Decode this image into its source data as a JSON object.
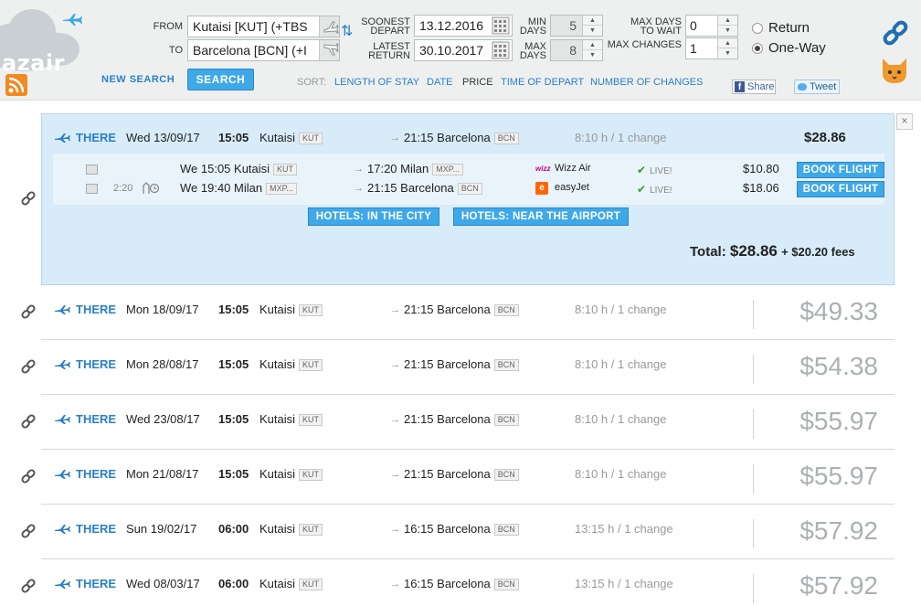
{
  "header": {
    "logo_text": "azair",
    "labels": {
      "from": "FROM",
      "to": "TO",
      "soonest_depart": [
        "SOONEST",
        "DEPART"
      ],
      "latest_return": [
        "LATEST",
        "RETURN"
      ],
      "min_days": [
        "MIN",
        "DAYS"
      ],
      "max_days": [
        "MAX",
        "DAYS"
      ],
      "max_days_wait": [
        "MAX DAYS",
        "TO WAIT"
      ],
      "max_changes": "MAX CHANGES"
    },
    "from_value": "Kutaisi [KUT] (+TBS",
    "to_value": "Barcelona [BCN] (+I",
    "soonest_depart_value": "13.12.2016",
    "latest_return_value": "30.10.2017",
    "min_days_value": "5",
    "max_days_value": "8",
    "max_days_wait_value": "0",
    "max_changes_value": "1",
    "trip_types": [
      {
        "label": "Return",
        "selected": false
      },
      {
        "label": "One-Way",
        "selected": true
      }
    ],
    "new_search": "NEW SEARCH",
    "search_button": "SEARCH",
    "sort_label": "SORT:",
    "sort_options": [
      {
        "label": "LENGTH OF STAY",
        "active": false
      },
      {
        "label": "DATE",
        "active": false
      },
      {
        "label": "PRICE",
        "active": true
      },
      {
        "label": "TIME OF DEPART",
        "active": false
      },
      {
        "label": "NUMBER OF CHANGES",
        "active": false
      }
    ],
    "share_label": "Share",
    "tweet_label": "Tweet"
  },
  "expanded": {
    "close": "×",
    "direction": "THERE",
    "date": "Wed 13/09/17",
    "depart_time": "15:05",
    "depart_city": "Kutaisi",
    "depart_code": "KUT",
    "arrive": "21:15 Barcelona",
    "arrive_code": "BCN",
    "duration": "8:10 h / 1 change",
    "price": "$28.86",
    "segments": [
      {
        "layover": "",
        "from": "We 15:05 Kutaisi",
        "from_code": "KUT",
        "to": "17:20 Milan",
        "to_code": "MXP...",
        "airline": "Wizz Air",
        "airline_logo": "wizz",
        "live": "LIVE!",
        "price": "$10.80",
        "book": "BOOK FLIGHT"
      },
      {
        "layover": "2:20",
        "from": "We 19:40 Milan",
        "from_code": "MXP...",
        "to": "21:15 Barcelona",
        "to_code": "BCN",
        "airline": "easyJet",
        "airline_logo": "e",
        "live": "LIVE!",
        "price": "$18.06",
        "book": "BOOK FLIGHT"
      }
    ],
    "hotels_city": "HOTELS: IN THE CITY",
    "hotels_airport": "HOTELS: NEAR THE AIRPORT",
    "total_label": "Total:",
    "total_value": "$28.86",
    "fees": "+ $20.20 fees"
  },
  "results": [
    {
      "direction": "THERE",
      "date": "Mon 18/09/17",
      "time": "15:05",
      "city": "Kutaisi",
      "code": "KUT",
      "arrive": "21:15 Barcelona",
      "arrive_code": "BCN",
      "duration": "8:10 h / 1 change",
      "price": "$49.33"
    },
    {
      "direction": "THERE",
      "date": "Mon 28/08/17",
      "time": "15:05",
      "city": "Kutaisi",
      "code": "KUT",
      "arrive": "21:15 Barcelona",
      "arrive_code": "BCN",
      "duration": "8:10 h / 1 change",
      "price": "$54.38"
    },
    {
      "direction": "THERE",
      "date": "Wed 23/08/17",
      "time": "15:05",
      "city": "Kutaisi",
      "code": "KUT",
      "arrive": "21:15 Barcelona",
      "arrive_code": "BCN",
      "duration": "8:10 h / 1 change",
      "price": "$55.97"
    },
    {
      "direction": "THERE",
      "date": "Mon 21/08/17",
      "time": "15:05",
      "city": "Kutaisi",
      "code": "KUT",
      "arrive": "21:15 Barcelona",
      "arrive_code": "BCN",
      "duration": "8:10 h / 1 change",
      "price": "$55.97"
    },
    {
      "direction": "THERE",
      "date": "Sun 19/02/17",
      "time": "06:00",
      "city": "Kutaisi",
      "code": "KUT",
      "arrive": "16:15 Barcelona",
      "arrive_code": "BCN",
      "duration": "13:15 h / 1 change",
      "price": "$57.92"
    },
    {
      "direction": "THERE",
      "date": "Wed 08/03/17",
      "time": "06:00",
      "city": "Kutaisi",
      "code": "KUT",
      "arrive": "16:15 Barcelona",
      "arrive_code": "BCN",
      "duration": "13:15 h / 1 change",
      "price": "$57.92"
    }
  ],
  "colors": {
    "accent": "#2a7fc6",
    "button": "#3fa8e8",
    "expanded_bg": "#d7ebf8",
    "price_muted": "#aab0b3"
  }
}
